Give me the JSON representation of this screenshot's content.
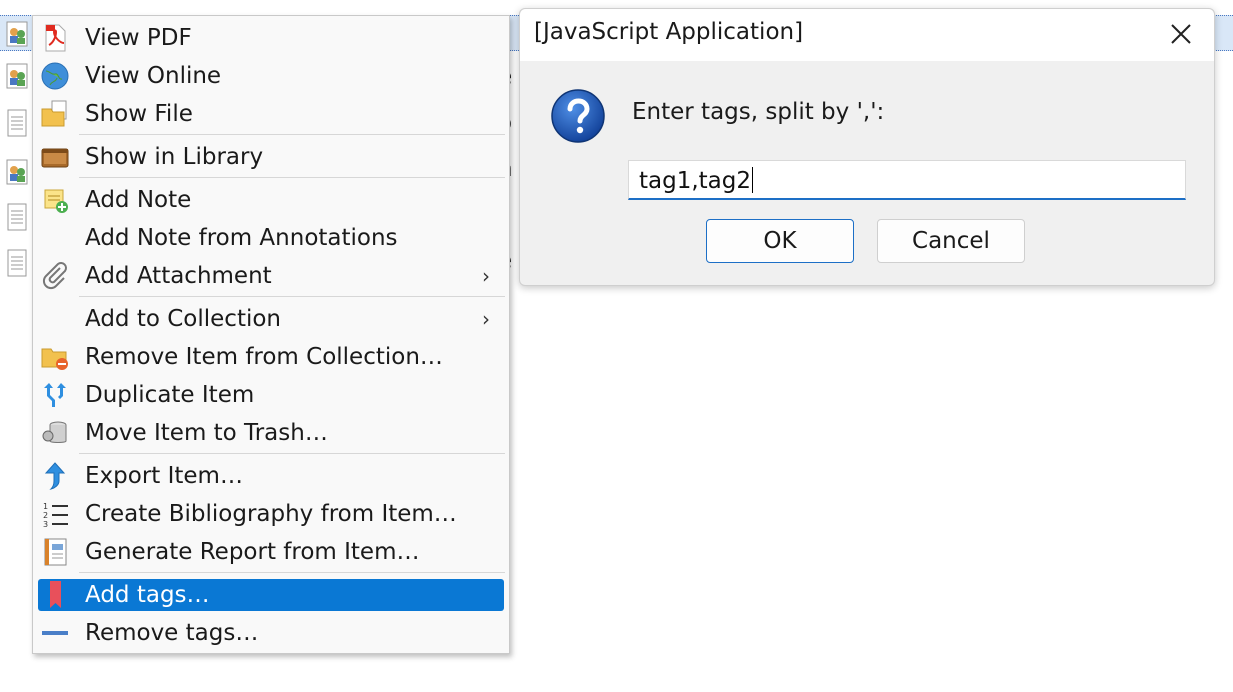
{
  "menu": {
    "items": [
      {
        "label": "View PDF",
        "icon": "pdf-icon"
      },
      {
        "label": "View Online",
        "icon": "globe-icon"
      },
      {
        "label": "Show File",
        "icon": "folder-file-icon"
      },
      {
        "label": "Show in Library",
        "icon": "library-box-icon"
      },
      {
        "label": "Add Note",
        "icon": "add-note-icon"
      },
      {
        "label": "Add Note from Annotations",
        "icon": ""
      },
      {
        "label": "Add Attachment",
        "icon": "paperclip-icon",
        "submenu": true
      },
      {
        "label": "Add to Collection",
        "icon": "",
        "submenu": true
      },
      {
        "label": "Remove Item from Collection…",
        "icon": "remove-from-collection-icon"
      },
      {
        "label": "Duplicate Item",
        "icon": "duplicate-icon"
      },
      {
        "label": "Move Item to Trash…",
        "icon": "trash-icon"
      },
      {
        "label": "Export Item…",
        "icon": "export-arrow-icon"
      },
      {
        "label": "Create Bibliography from Item…",
        "icon": "bibliography-list-icon"
      },
      {
        "label": "Generate Report from Item…",
        "icon": "report-icon"
      },
      {
        "label": "Add tags…",
        "icon": "bookmark-tag-icon",
        "highlighted": true
      },
      {
        "label": "Remove tags…",
        "icon": "minus-icon"
      }
    ],
    "submenu_arrow": "›"
  },
  "dialog": {
    "title": "[JavaScript Application]",
    "prompt": "Enter tags, split by ',':",
    "input_value": "tag1,tag2",
    "ok_label": "OK",
    "cancel_label": "Cancel",
    "colors": {
      "accent": "#0a78d4",
      "focus_border": "#1d6fc6"
    }
  },
  "background": {
    "fragments": [
      "e",
      "e",
      "o",
      "n",
      "c",
      "e"
    ]
  }
}
